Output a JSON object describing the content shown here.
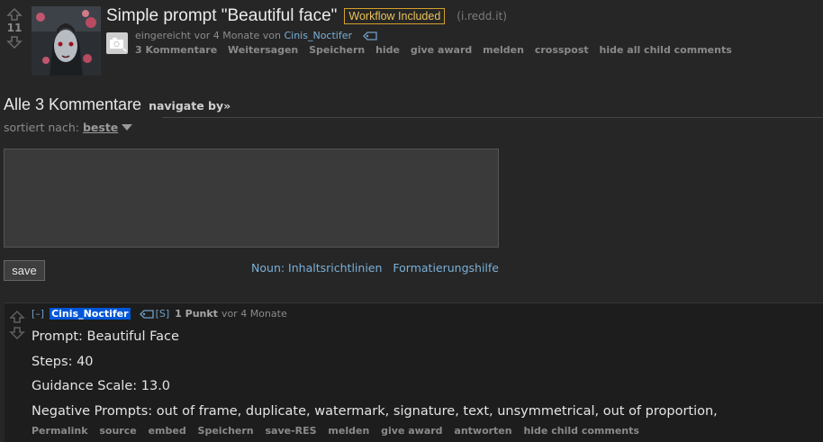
{
  "post": {
    "score": "11",
    "title": "Simple prompt \"Beautiful face\"",
    "flair": "Workflow Included",
    "domain": "(i.redd.it)",
    "submitted_prefix": "eingereicht vor 4 Monate von",
    "author": "Cinis_Noctifer",
    "buttons": [
      "3 Kommentare",
      "Weitersagen",
      "Speichern",
      "hide",
      "give award",
      "melden",
      "crosspost",
      "hide all child comments"
    ]
  },
  "comments_section": {
    "title": "Alle 3 Kommentare",
    "navigate": "navigate by",
    "sort_label": "sortiert nach:",
    "sort_value": "beste",
    "save_label": "save",
    "link_rules": "Noun: Inhaltsrichtlinien",
    "link_format": "Formatierungshilfe"
  },
  "comment": {
    "expand": "[–]",
    "author": "Cinis_Noctifer",
    "tag": "[S]",
    "points": "1 Punkt",
    "age": "vor 4 Monate",
    "lines": [
      "Prompt: Beautiful Face",
      "Steps: 40",
      "Guidance Scale: 13.0",
      "Negative Prompts: out of frame, duplicate, watermark, signature, text, unsymmetrical, out of proportion,"
    ],
    "buttons": [
      "Permalink",
      "source",
      "embed",
      "Speichern",
      "save-RES",
      "melden",
      "give award",
      "antworten",
      "hide child comments"
    ]
  },
  "colors": {
    "background": "#262626",
    "author_link": "#7bb0d8",
    "flair_border": "#d4a12b",
    "author_badge": "#0057d9"
  }
}
